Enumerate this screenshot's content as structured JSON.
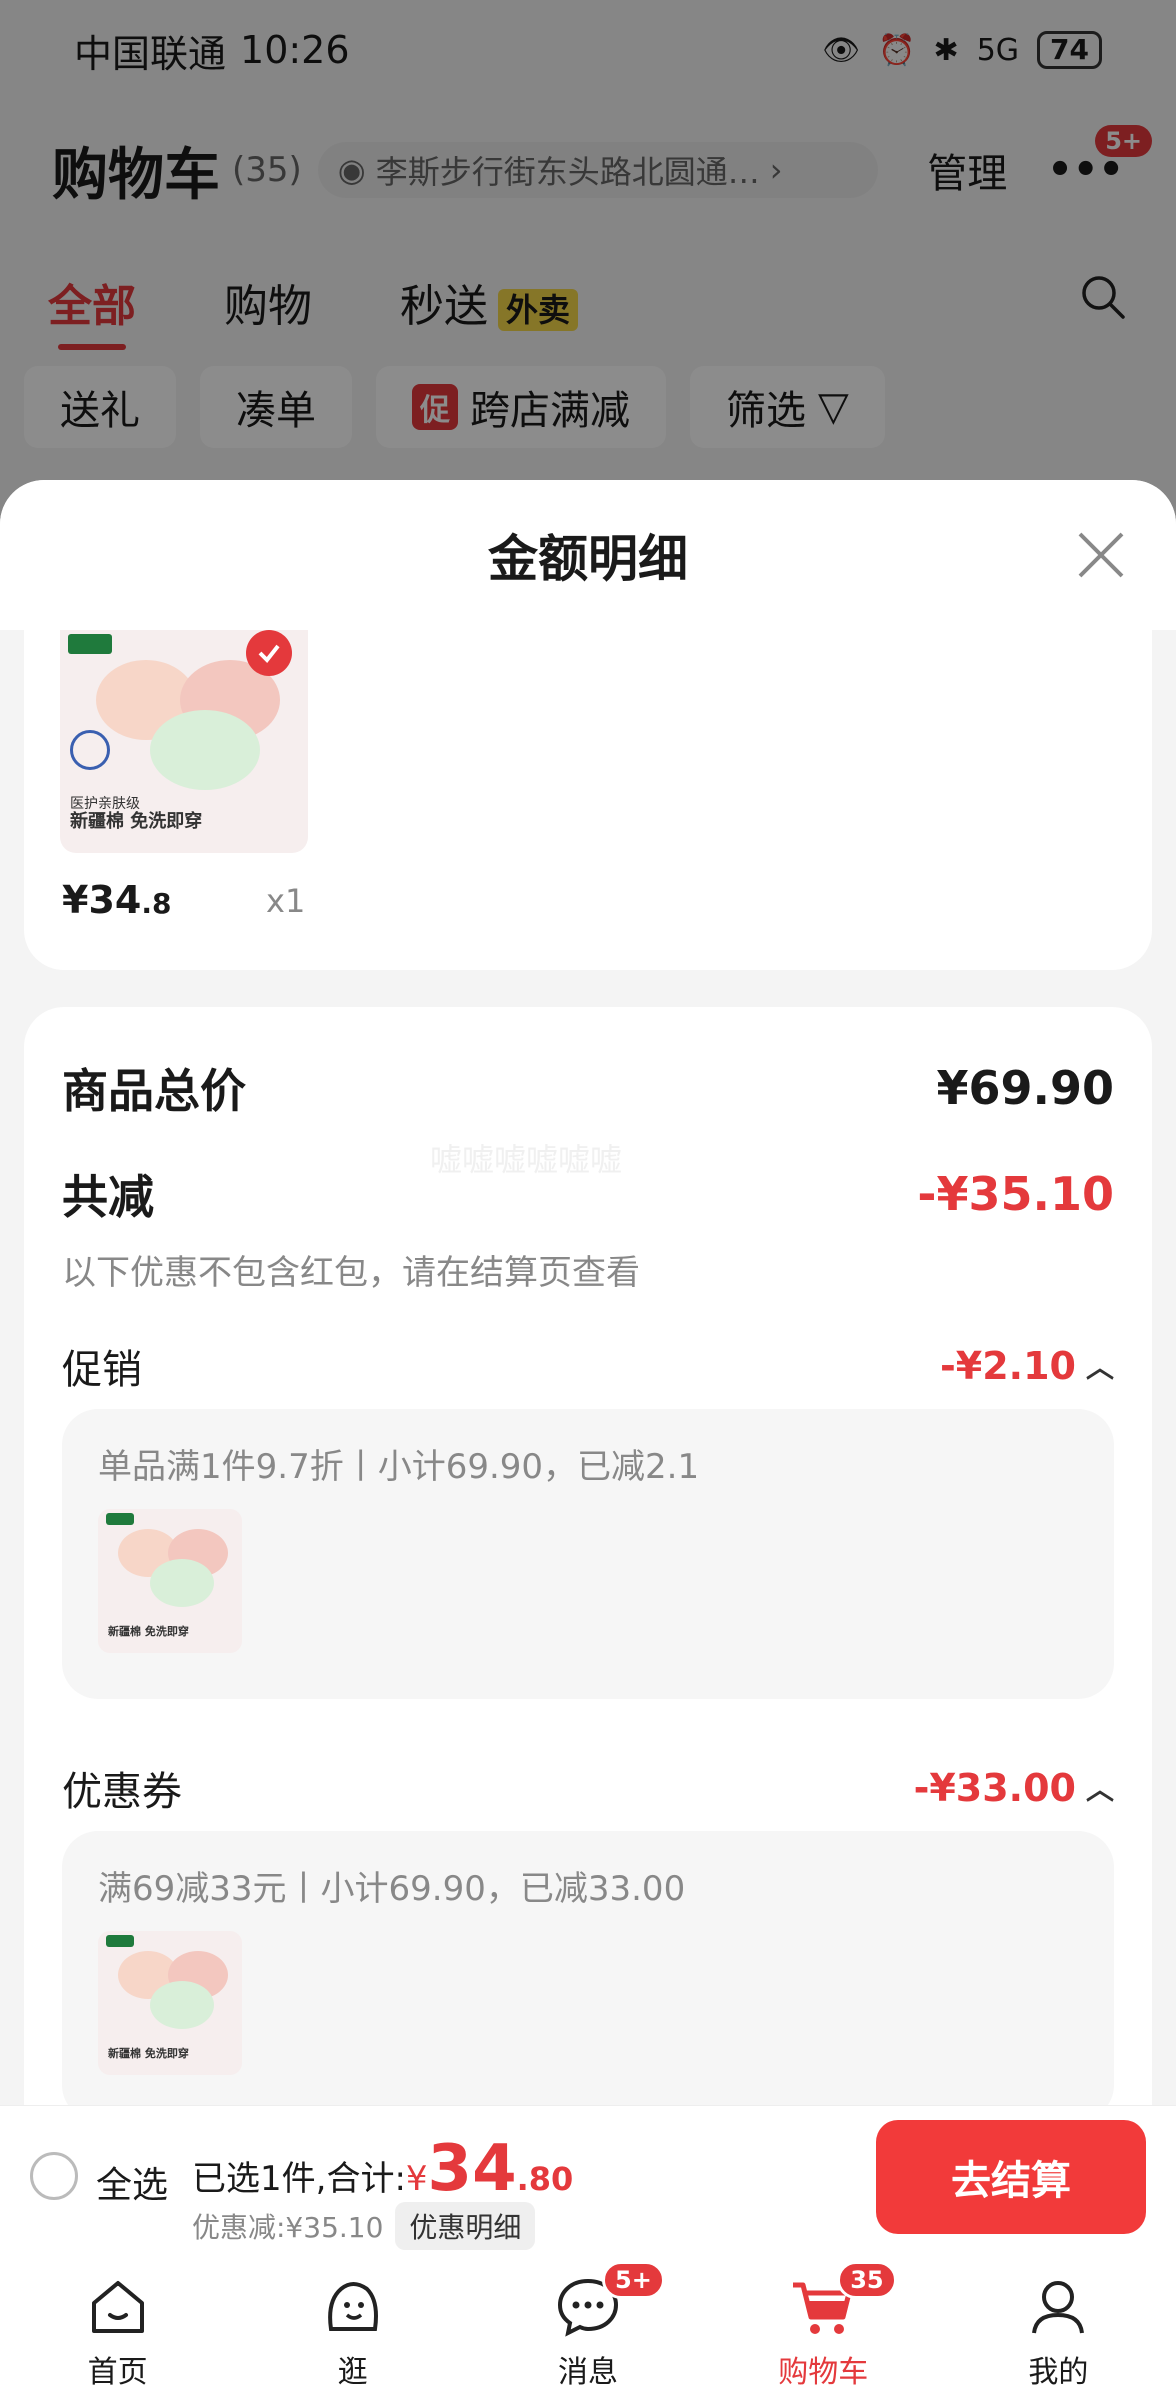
{
  "status_bar": {
    "carrier": "中国联通",
    "time": "10:26",
    "signal": "5G",
    "battery": "74"
  },
  "cart_header": {
    "title": "购物车",
    "count": "(35)",
    "address": "李斯步行街东头路北圆通…",
    "manage": "管理",
    "more_badge": "5+"
  },
  "tabs": [
    {
      "label": "全部",
      "active": true
    },
    {
      "label": "购物"
    },
    {
      "label": "秒送",
      "tag": "外卖"
    }
  ],
  "filter_chips": [
    {
      "label": "送礼"
    },
    {
      "label": "凑单"
    },
    {
      "label": "跨店满减",
      "promo_icon": "促"
    },
    {
      "label": "筛选"
    }
  ],
  "sheet": {
    "title": "金额明细",
    "item": {
      "price_main": "¥34",
      "price_cents": ".8",
      "qty": "x1",
      "thumb_text": "新疆棉 免洗即穿",
      "thumb_badge": "医护亲肤级"
    },
    "summary": {
      "total_label": "商品总价",
      "total_value": "¥69.90",
      "reduce_label": "共减",
      "reduce_value": "-¥35.10",
      "note": "以下优惠不包含红包，请在结算页查看",
      "watermark": "嘘嘘嘘嘘嘘嘘"
    },
    "promotion": {
      "label": "促销",
      "value": "-¥2.10",
      "detail": "单品满1件9.7折丨小计69.90，已减2.1",
      "thumb_text": "新疆棉 免洗即穿"
    },
    "coupon": {
      "label": "优惠券",
      "value": "-¥33.00",
      "detail": "满69减33元丨小计69.90，已减33.00",
      "thumb_text": "新疆棉 免洗即穿"
    }
  },
  "bottom_bar": {
    "select_all": "全选",
    "selected_prefix": "已选1件,合计:",
    "currency": "¥",
    "total_main": "34",
    "total_cents": ".80",
    "discount": "优惠减:¥35.10",
    "detail_button": "优惠明细",
    "checkout": "去结算"
  },
  "nav": [
    {
      "label": "首页",
      "icon": "home-icon"
    },
    {
      "label": "逛",
      "icon": "browse-icon"
    },
    {
      "label": "消息",
      "icon": "message-icon",
      "badge": "5+"
    },
    {
      "label": "购物车",
      "icon": "cart-icon",
      "badge": "35",
      "active": true
    },
    {
      "label": "我的",
      "icon": "profile-icon"
    }
  ],
  "colors": {
    "accent": "#e4393c",
    "checkout": "#f23a3a"
  }
}
